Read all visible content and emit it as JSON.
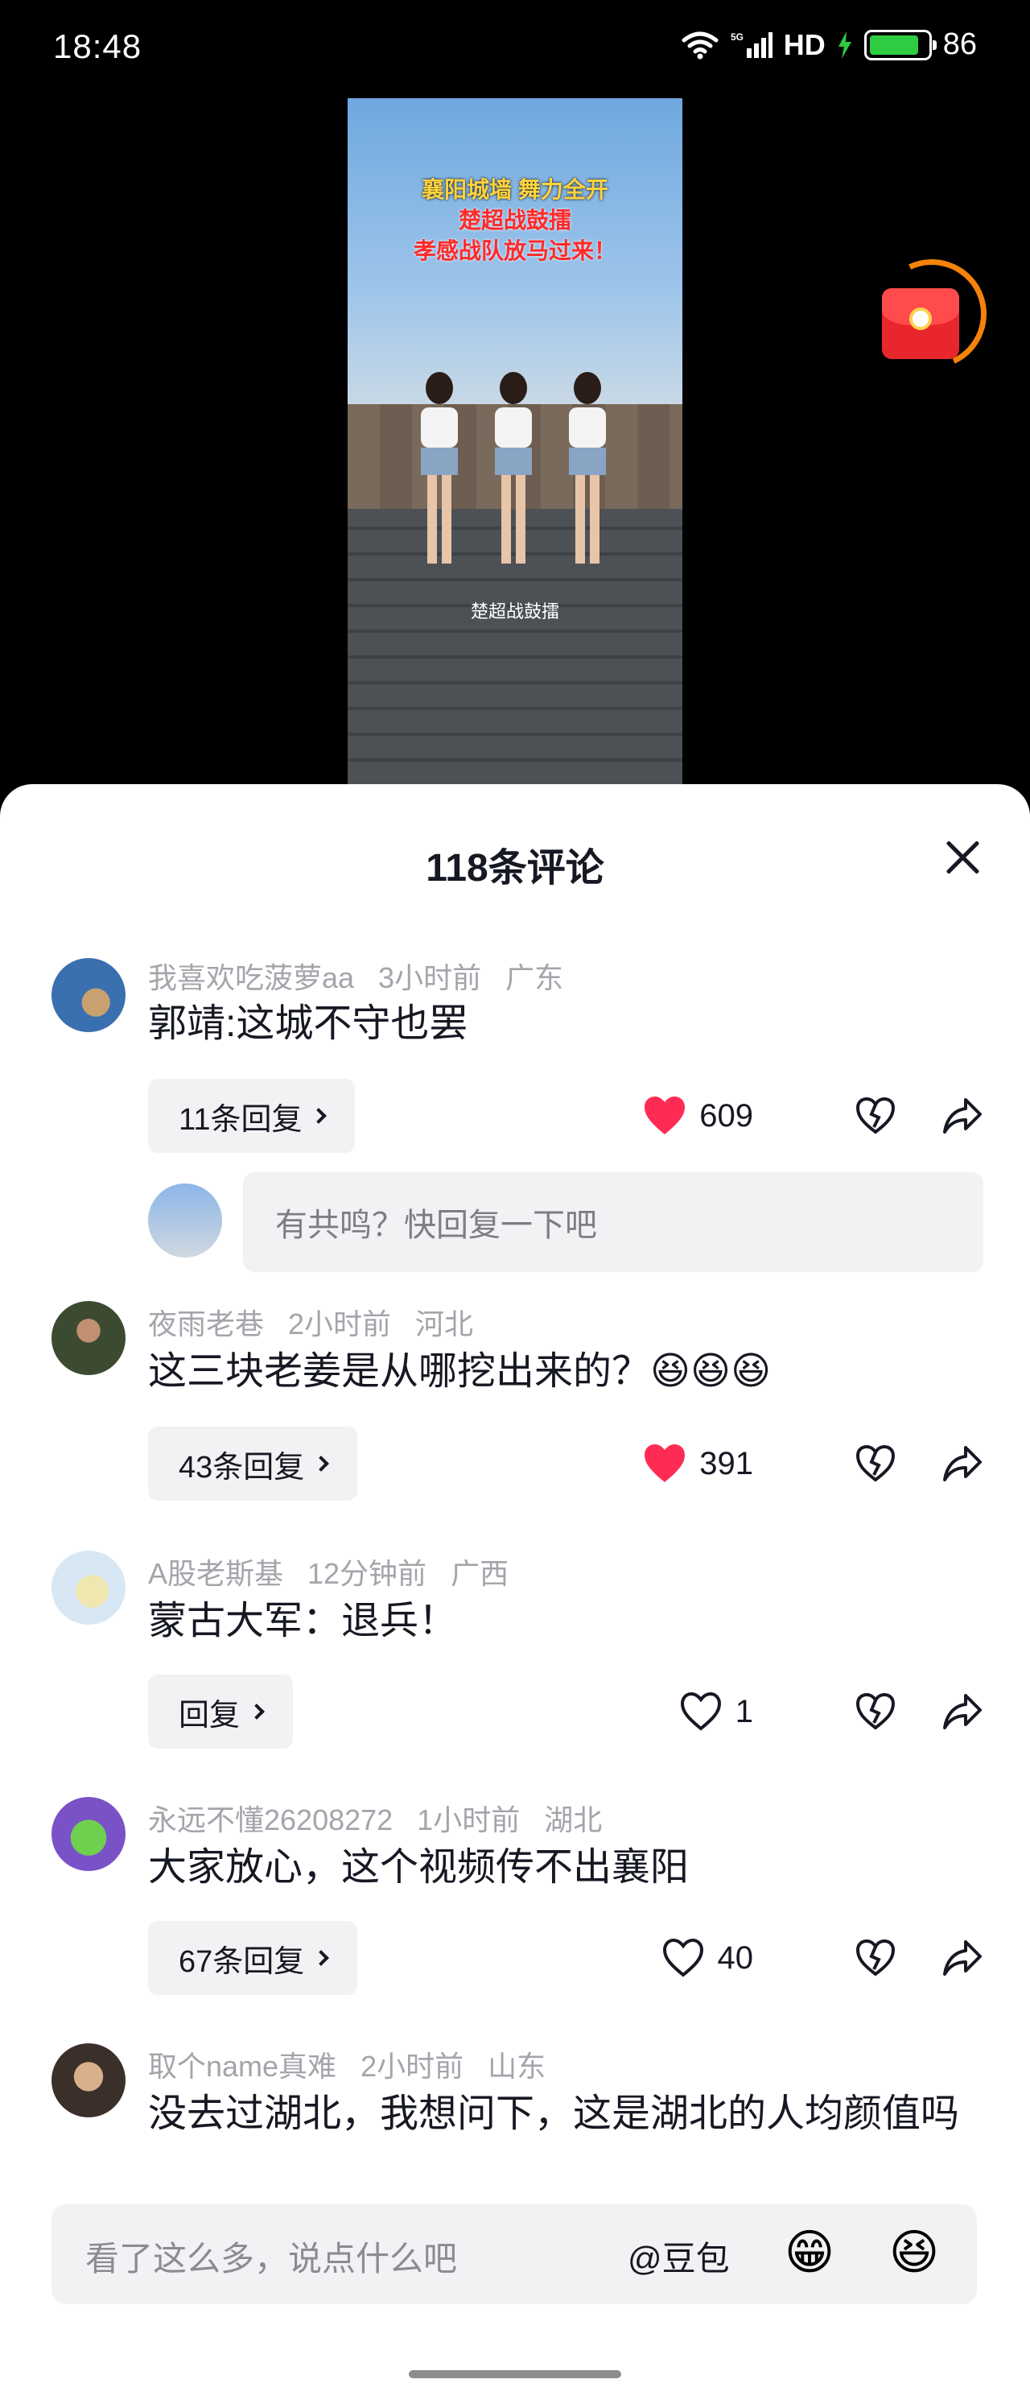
{
  "status_bar": {
    "time": "18:48",
    "network": "5G",
    "hd": "HD",
    "battery": "86"
  },
  "video": {
    "caption_lines": [
      "襄阳城墙 舞力全开",
      "楚超战鼓擂",
      "孝感战队放马过来！"
    ],
    "subtitle": "楚超战鼓擂"
  },
  "sheet": {
    "title": "118条评论"
  },
  "comments": [
    {
      "user": "我喜欢吃菠萝aa",
      "time": "3小时前",
      "location": "广东",
      "text": "郭靖:这城不守也罢",
      "replies": "11条回复",
      "likes": "609",
      "liked": true,
      "quick_reply_placeholder": "有共鸣？快回复一下吧"
    },
    {
      "user": "夜雨老巷",
      "time": "2小时前",
      "location": "河北",
      "text": "这三块老姜是从哪挖出来的？😆😆😆",
      "replies": "43条回复",
      "likes": "391",
      "liked": true
    },
    {
      "user": "A股老斯基",
      "time": "12分钟前",
      "location": "广西",
      "text": "蒙古大军：退兵！",
      "replies": "回复",
      "likes": "1",
      "liked": false
    },
    {
      "user": "永远不懂26208272",
      "time": "1小时前",
      "location": "湖北",
      "text": "大家放心，这个视频传不出襄阳",
      "replies": "67条回复",
      "likes": "40",
      "liked": false
    },
    {
      "user": "取个name真难",
      "time": "2小时前",
      "location": "山东",
      "text": "没去过湖北，我想问下，这是湖北的人均颜值吗"
    }
  ],
  "input_bar": {
    "placeholder": "看了这么多，说点什么吧",
    "mention": "@豆包",
    "emoji_1": "😁",
    "emoji_2": "😆"
  },
  "colors": {
    "like_red": "#fe2c55",
    "sheet_bg": "#ffffff",
    "text_primary": "#161823",
    "text_meta": "#a3a5ab"
  }
}
